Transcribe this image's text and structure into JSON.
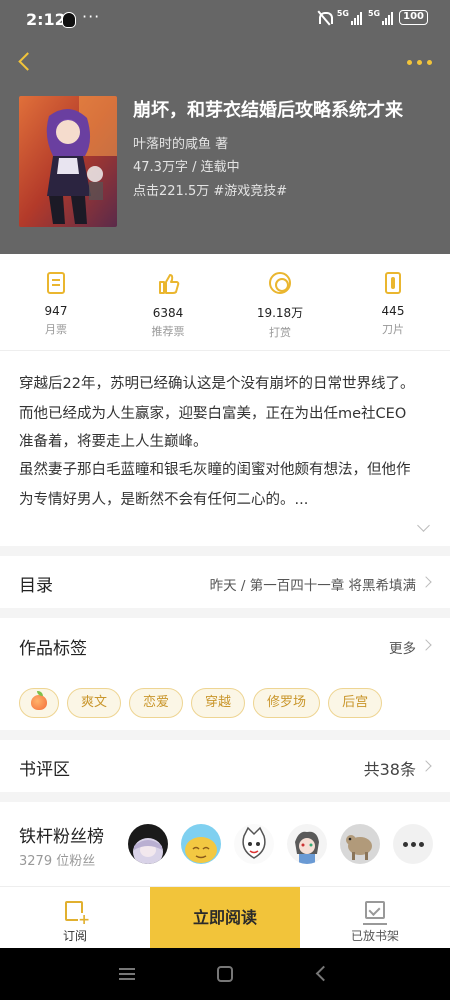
{
  "status_bar": {
    "time": "2:12",
    "dots": "···",
    "signal_label_1": "5G",
    "signal_label_2": "5G",
    "battery": "100"
  },
  "book": {
    "title": "崩坏，和芽衣结婚后攻略系统才来",
    "author": "叶落时的咸鱼  著",
    "word_status": "47.3万字 / 连载中",
    "clicks_tag": "点击221.5万  #游戏竞技#"
  },
  "stats": [
    {
      "icon": "monthly-ticket-icon",
      "value": "947",
      "label": "月票"
    },
    {
      "icon": "thumbs-up-icon",
      "value": "6384",
      "label": "推荐票"
    },
    {
      "icon": "coin-icon",
      "value": "19.18万",
      "label": "打赏"
    },
    {
      "icon": "blade-icon",
      "value": "445",
      "label": "刀片"
    }
  ],
  "synopsis": {
    "line1": "穿越后22年，苏明已经确认这是个没有崩坏的日常世界线了。",
    "line2": "而他已经成为人生赢家，迎娶白富美，正在为出任me社CEO",
    "line3": "准备着，将要走上人生巅峰。",
    "line4": "虽然妻子那白毛蓝瞳和银毛灰瞳的闺蜜对他颇有想法，但他作",
    "line5": "为专情好男人，是断然不会有任何二心的。..."
  },
  "toc": {
    "title": "目录",
    "latest": "昨天 / 第一百四十一章 将黑希填满"
  },
  "tags_section": {
    "title": "作品标签",
    "more": "更多",
    "tags": [
      "爽文",
      "恋爱",
      "穿越",
      "修罗场",
      "后宫"
    ]
  },
  "reviews": {
    "title": "书评区",
    "count": "共38条"
  },
  "fans": {
    "title": "铁杆粉丝榜",
    "count": "3279 位粉丝"
  },
  "bottom_bar": {
    "subscribe": "订阅",
    "read_now": "立即阅读",
    "shelved": "已放书架"
  },
  "colors": {
    "accent": "#f2c43a",
    "header_bg": "#666666",
    "tag_text": "#c9962c"
  }
}
